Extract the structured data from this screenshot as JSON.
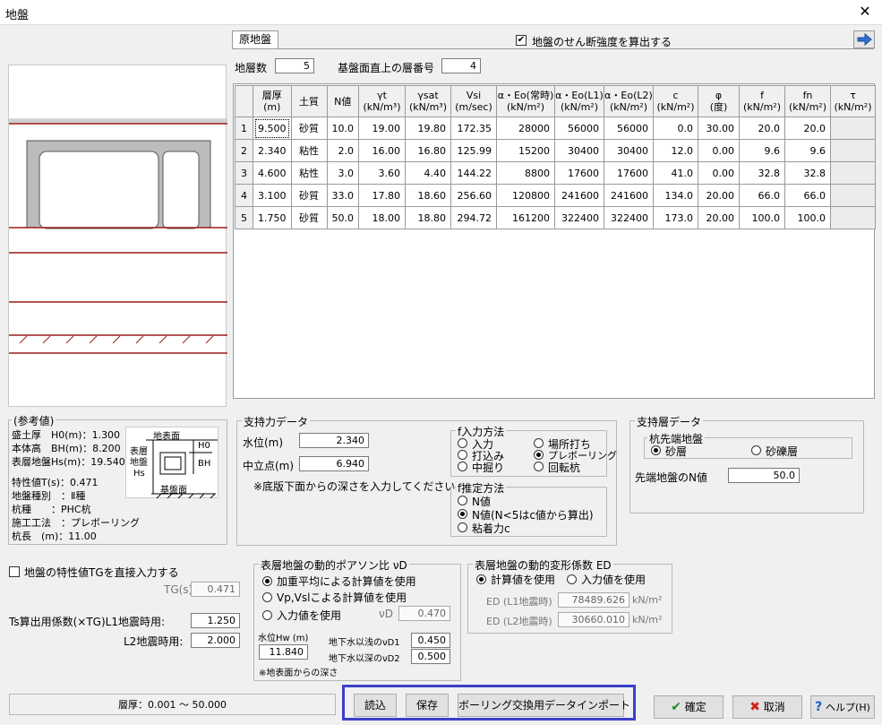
{
  "window": {
    "title": "地盤",
    "close_glyph": "✕"
  },
  "tab": {
    "label": "原地盤"
  },
  "shear": {
    "label": "地盤のせん断強度を算出する",
    "checked": true
  },
  "layers": {
    "count_label": "地層数",
    "count": "5",
    "base_label": "基盤面直上の層番号",
    "base": "4"
  },
  "table": {
    "headers": [
      [
        "層厚",
        "(m)"
      ],
      [
        "土質",
        ""
      ],
      [
        "N値",
        ""
      ],
      [
        "γt",
        "(kN/m³)"
      ],
      [
        "γsat",
        "(kN/m³)"
      ],
      [
        "Vsi",
        "(m/sec)"
      ],
      [
        "α・Eo(常時)",
        "(kN/m²)"
      ],
      [
        "α・Eo(L1)",
        "(kN/m²)"
      ],
      [
        "α・Eo(L2)",
        "(kN/m²)"
      ],
      [
        "c",
        "(kN/m²)"
      ],
      [
        "φ",
        "(度)"
      ],
      [
        "f",
        "(kN/m²)"
      ],
      [
        "fn",
        "(kN/m²)"
      ],
      [
        "τ",
        "(kN/m²)"
      ]
    ],
    "rows": [
      [
        "1",
        "9.500",
        "砂質",
        "10.0",
        "19.00",
        "19.80",
        "172.35",
        "28000",
        "56000",
        "56000",
        "0.0",
        "30.00",
        "20.0",
        "20.0",
        ""
      ],
      [
        "2",
        "2.340",
        "粘性",
        "2.0",
        "16.00",
        "16.80",
        "125.99",
        "15200",
        "30400",
        "30400",
        "12.0",
        "0.00",
        "9.6",
        "9.6",
        ""
      ],
      [
        "3",
        "4.600",
        "粘性",
        "3.0",
        "3.60",
        "4.40",
        "144.22",
        "8800",
        "17600",
        "17600",
        "41.0",
        "0.00",
        "32.8",
        "32.8",
        ""
      ],
      [
        "4",
        "3.100",
        "砂質",
        "33.0",
        "17.80",
        "18.60",
        "256.60",
        "120800",
        "241600",
        "241600",
        "134.0",
        "20.00",
        "66.0",
        "66.0",
        ""
      ],
      [
        "5",
        "1.750",
        "砂質",
        "50.0",
        "18.00",
        "18.80",
        "294.72",
        "161200",
        "322400",
        "322400",
        "173.0",
        "20.00",
        "100.0",
        "100.0",
        ""
      ]
    ]
  },
  "ref": {
    "title": "(参考値)",
    "lines": [
      "盛土厚　H0(m)：1.300",
      "本体高　BH(m)：8.200",
      "表層地盤Hs(m)：19.540",
      "特性値T(s)：0.471",
      "地盤種別　：Ⅱ種",
      "杭種　　：PHC杭",
      "施工工法　：プレボーリング",
      "杭長　(m)：11.00"
    ],
    "diagram": {
      "surface": "地表面",
      "h0": "H0",
      "bh": "BH",
      "hs": "表層地盤",
      "hs2": "Hs",
      "base": "基盤面"
    }
  },
  "support": {
    "title": "支持力データ",
    "water_label": "水位(m)",
    "water": "2.340",
    "mid_label": "中立点(m)",
    "mid": "6.940",
    "note": "※底版下面からの深さを入力してください。",
    "f_input": {
      "title": "f入力方法",
      "options": [
        "入力",
        "場所打ち",
        "打込み",
        "プレボーリング",
        "中掘り",
        "回転杭"
      ],
      "selected": 3
    },
    "f_est": {
      "title": "f推定方法",
      "options": [
        "N値",
        "N値(N<5はc値から算出)",
        "粘着力c"
      ],
      "selected": 1
    }
  },
  "layer_data": {
    "title": "支持層データ",
    "tip": {
      "title": "杭先端地盤",
      "options": [
        "砂層",
        "砂礫層"
      ],
      "selected": 0
    },
    "n_label": "先端地盤のN値",
    "n": "50.0"
  },
  "tg": {
    "label": "地盤の特性値TGを直接入力する",
    "tg_label": "TG(s)",
    "tg": "0.471",
    "coef_label": "Ts算出用係数(×TG)L1地震時用:",
    "l1": "1.250",
    "l2_label": "L2地震時用:",
    "l2": "2.000"
  },
  "poisson": {
    "title": "表層地盤の動的ポアソン比 νD",
    "options": [
      "加重平均による計算値を使用",
      "Vp,Vslこよる計算値を使用",
      "入力値を使用"
    ],
    "selected": 0,
    "nud_label": "νD",
    "nud": "0.470",
    "hw_label": "水位Hw (m)",
    "hw": "11.840",
    "shallow_label": "地下水以浅のνD1",
    "shallow": "0.450",
    "deep_label": "地下水以深のνD2",
    "deep": "0.500",
    "note": "※地表面からの深さ"
  },
  "deform": {
    "title": "表層地盤の動的変形係数 ED",
    "options": [
      "計算値を使用",
      "入力値を使用"
    ],
    "selected": 0,
    "ed1_label": "ED (L1地震時)",
    "ed1": "78489.626",
    "ed2_label": "ED (L2地震時)",
    "ed2": "30660.010",
    "unit": "kN/m²"
  },
  "status": {
    "text": "層厚：0.001 ～ 50.000"
  },
  "buttons": {
    "read": "読込",
    "save": "保存",
    "import": "ボーリング交換用データインポート",
    "ok": "確定",
    "cancel": "取消",
    "help": "ヘルプ(H)"
  },
  "colors": {
    "accent": "#3a41c8",
    "line": "#9b1c1c"
  }
}
